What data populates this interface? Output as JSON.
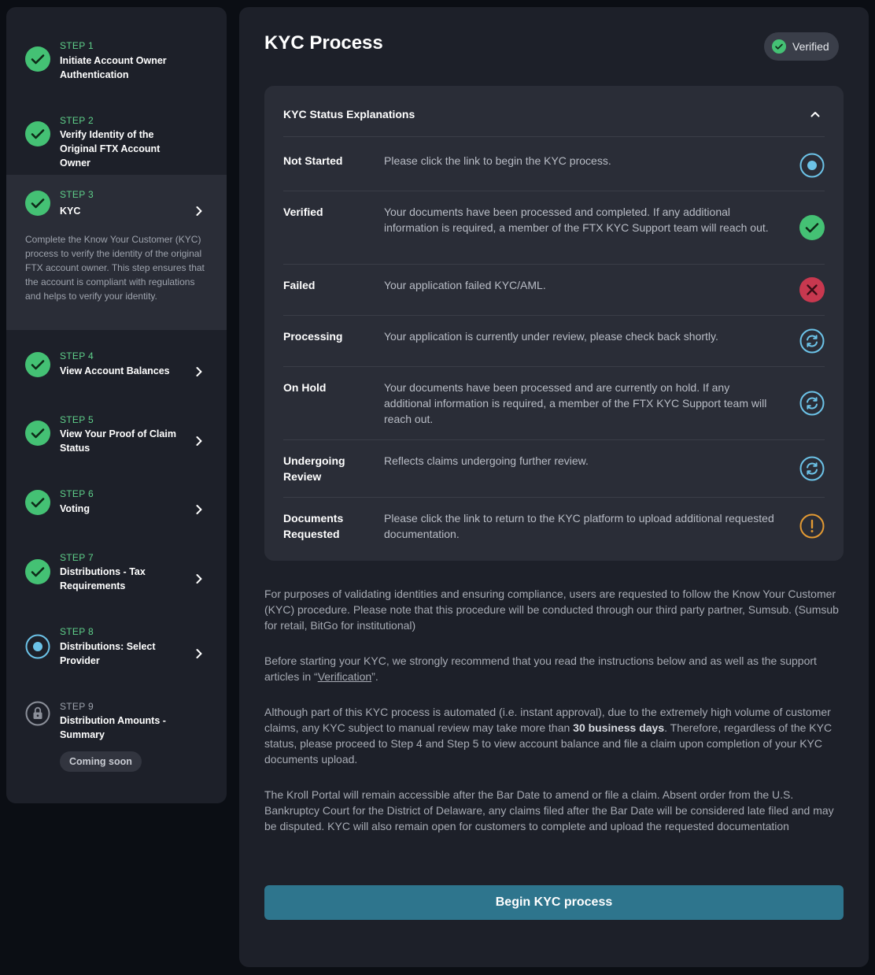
{
  "sidebar": {
    "steps": [
      {
        "num": "STEP 1",
        "title": "Initiate Account Owner Authentication",
        "status": "complete"
      },
      {
        "num": "STEP 2",
        "title": "Verify Identity of the Original FTX Account Owner",
        "status": "complete"
      },
      {
        "num": "STEP 3",
        "title": "KYC",
        "status": "complete",
        "description": "Complete the Know Your Customer (KYC) process to verify the identity of the original FTX account owner. This step ensures that the account is compliant with regulations and helps to verify your identity."
      },
      {
        "num": "STEP 4",
        "title": "View Account Balances",
        "status": "complete"
      },
      {
        "num": "STEP 5",
        "title": "View Your Proof of Claim Status",
        "status": "complete"
      },
      {
        "num": "STEP 6",
        "title": "Voting",
        "status": "complete"
      },
      {
        "num": "STEP 7",
        "title": "Distributions - Tax Requirements",
        "status": "complete"
      },
      {
        "num": "STEP 8",
        "title": "Distributions: Select Provider",
        "status": "in-progress"
      },
      {
        "num": "STEP 9",
        "title": "Distribution Amounts - Summary",
        "status": "locked",
        "badge": "Coming soon"
      }
    ]
  },
  "main": {
    "title": "KYC Process",
    "status_pill": "Verified",
    "card": {
      "heading": "KYC Status Explanations",
      "rows": [
        {
          "label": "Not Started",
          "text": "Please click the link to begin the KYC process.",
          "icon": "not-started-icon"
        },
        {
          "label": "Verified",
          "text": "Your documents have been processed and completed. If any additional information is required, a member of the FTX KYC Support team will reach out.",
          "icon": "check-icon"
        },
        {
          "label": "Failed",
          "text": "Your application failed KYC/AML.",
          "icon": "x-icon"
        },
        {
          "label": "Processing",
          "text": "Your application is currently under review, please check back shortly.",
          "icon": "refresh-icon"
        },
        {
          "label": "On Hold",
          "text": "Your documents have been processed and are currently on hold. If any additional information is required, a member of the FTX KYC Support team will reach out.",
          "icon": "refresh-icon"
        },
        {
          "label": "Undergoing Review",
          "text": "Reflects claims undergoing further review.",
          "icon": "refresh-icon"
        },
        {
          "label": "Documents Requested",
          "text": "Please click the link to return to the KYC platform to upload additional requested documentation.",
          "icon": "exclamation-icon"
        }
      ]
    },
    "paragraphs": {
      "p1": "For purposes of validating identities and ensuring compliance, users are requested to follow the Know Your Customer (KYC) procedure. Please note that this procedure will be conducted through our third party partner, Sumsub. (Sumsub for retail, BitGo for institutional)",
      "p2_before": "Before starting your KYC, we strongly recommend that you read the instructions below and as well as the support articles in “",
      "p2_link": "Verification",
      "p2_after": "”.",
      "p3_before": "Although part of this KYC process is automated (i.e. instant approval), due to the extremely high volume of customer claims, any KYC subject to manual review may take more than ",
      "p3_bold": "30 business days",
      "p3_after": ". Therefore, regardless of the KYC status, please proceed to Step 4 and Step 5 to view account balance and file a claim upon completion of your KYC documents upload.",
      "p4": "The Kroll Portal will remain accessible after the Bar Date to amend or file a claim. Absent order from the U.S. Bankruptcy Court for the District of Delaware, any claims filed after the Bar Date will be considered late filed and may be disputed. KYC will also remain open for customers to complete and upload the requested documentation"
    },
    "begin_button": "Begin KYC process"
  },
  "colors": {
    "success": "#44c174",
    "step_number": "#5fd08a",
    "error": "#c8384f",
    "info": "#6cc3e8",
    "warning": "#e39a33",
    "button": "#2e758d"
  }
}
